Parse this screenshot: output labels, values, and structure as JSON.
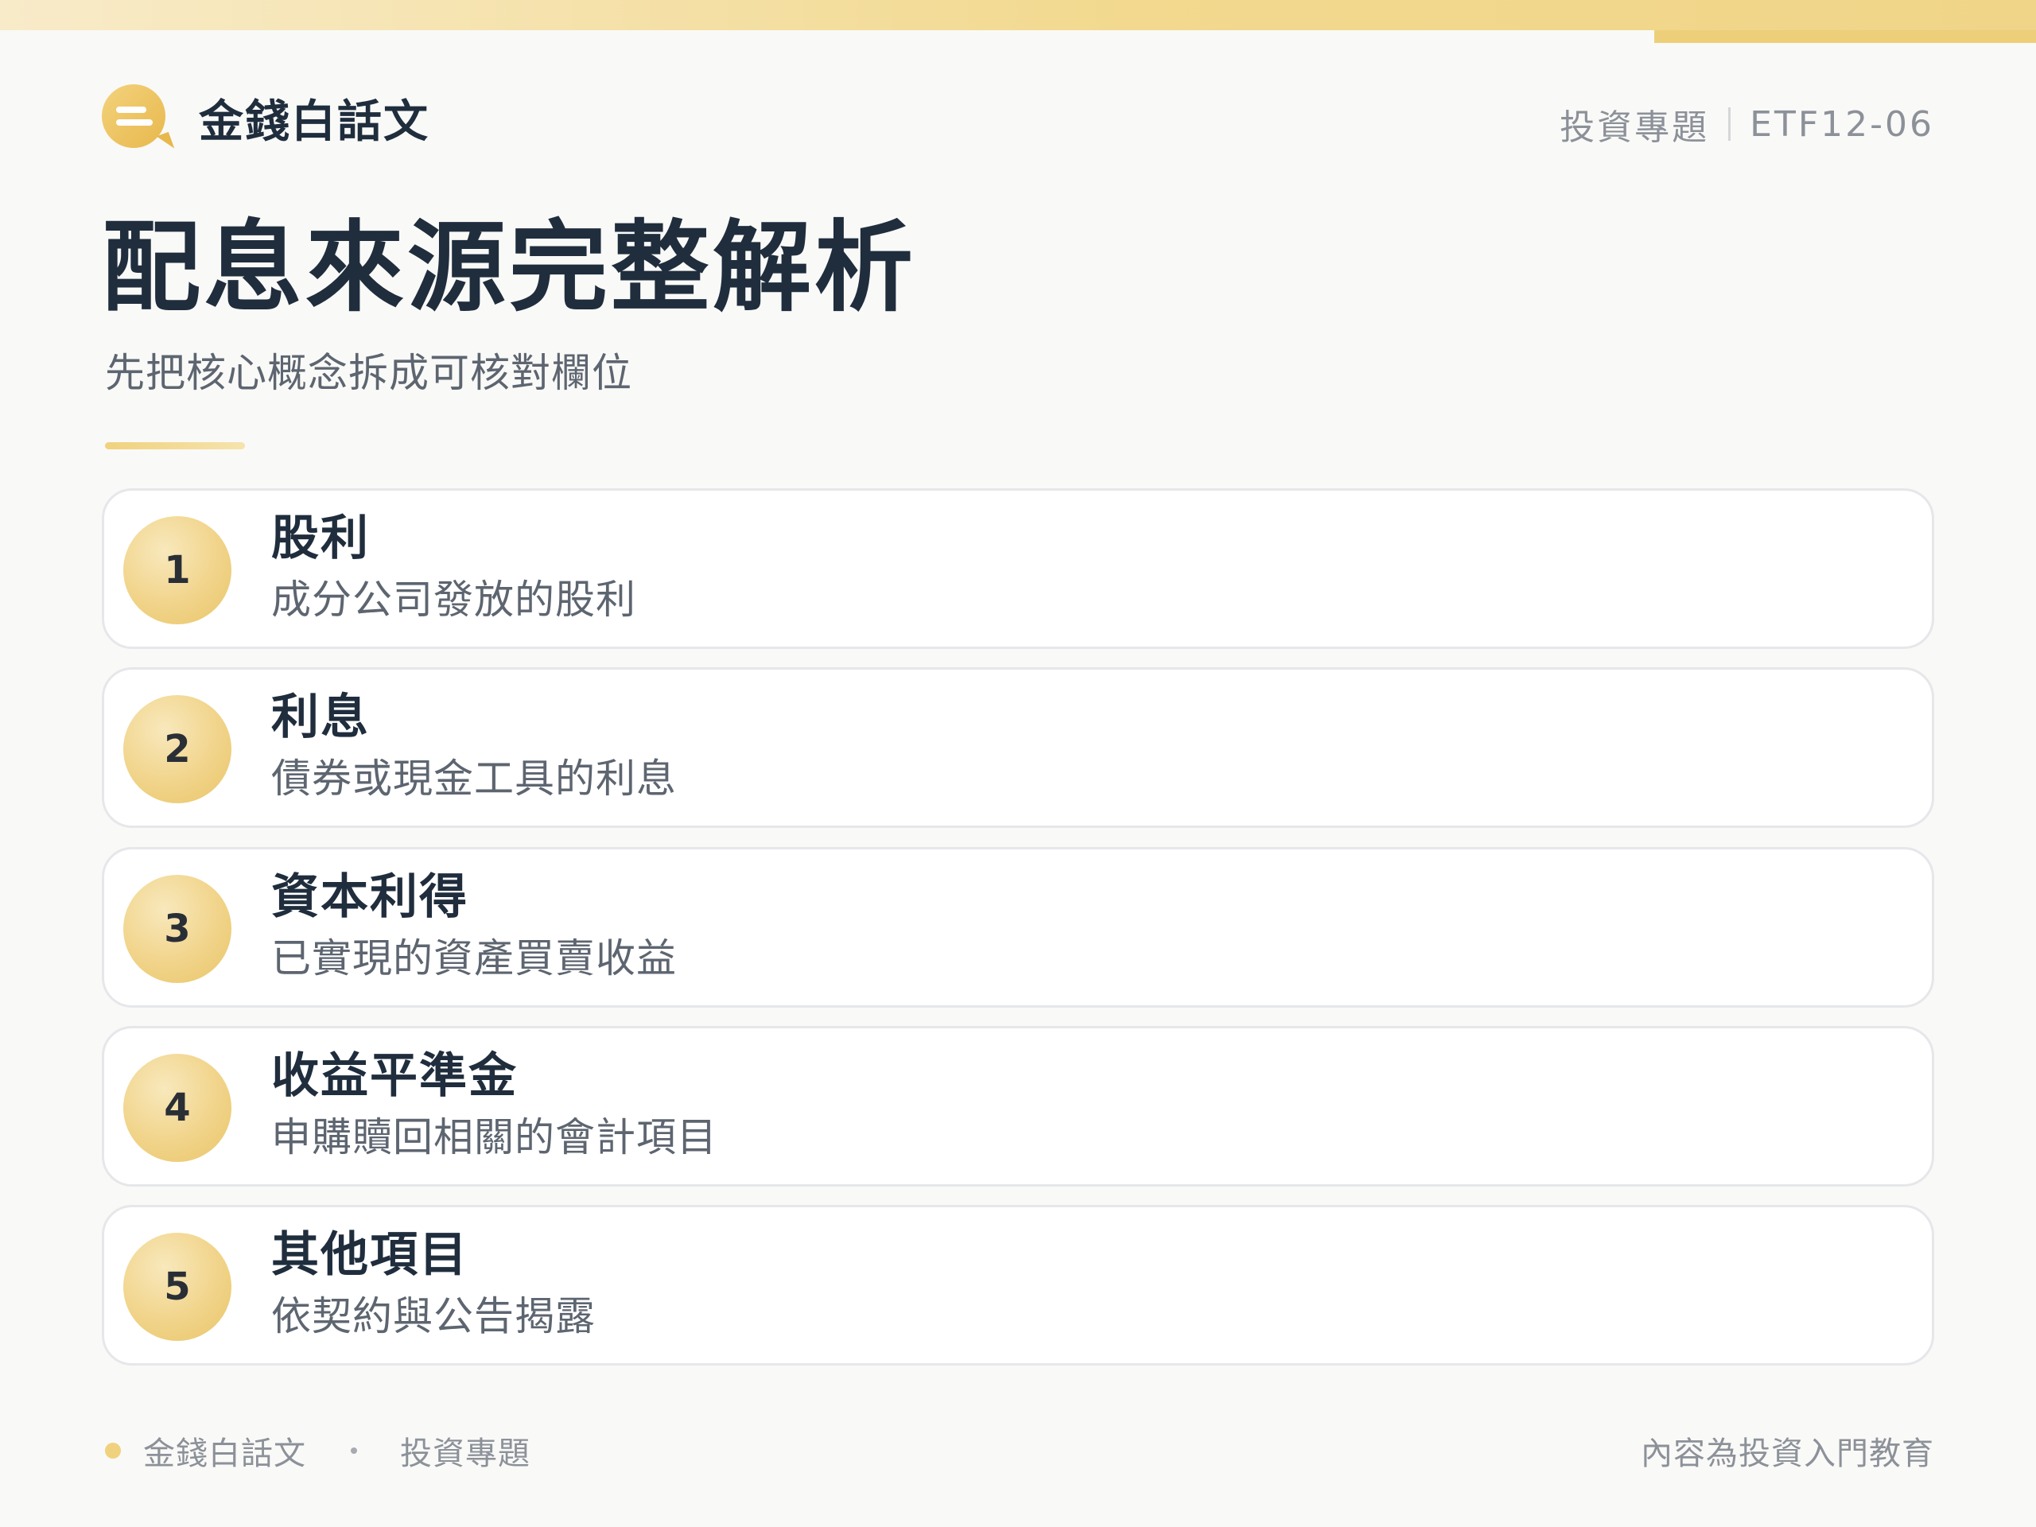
{
  "brand": {
    "name": "金錢白話文",
    "logo_icon": "chat-bubble-icon",
    "accent_color": "#e8b84d"
  },
  "header": {
    "topic": "投資專題",
    "code": "ETF12-06"
  },
  "page": {
    "title": "配息來源完整解析",
    "subtitle": "先把核心概念拆成可核對欄位"
  },
  "items": [
    {
      "number": "1",
      "title": "股利",
      "description": "成分公司發放的股利"
    },
    {
      "number": "2",
      "title": "利息",
      "description": "債券或現金工具的利息"
    },
    {
      "number": "3",
      "title": "資本利得",
      "description": "已實現的資產買賣收益"
    },
    {
      "number": "4",
      "title": "收益平準金",
      "description": "申購贖回相關的會計項目"
    },
    {
      "number": "5",
      "title": "其他項目",
      "description": "依契約與公告揭露"
    }
  ],
  "footer": {
    "brand": "金錢白話文",
    "topic": "投資專題",
    "note": "內容為投資入門教育"
  },
  "colors": {
    "text_primary": "#1f2d3d",
    "text_secondary": "#5d6570",
    "text_muted": "#8c9199",
    "gold": "#f0d27e",
    "background": "#f9f9f7"
  }
}
